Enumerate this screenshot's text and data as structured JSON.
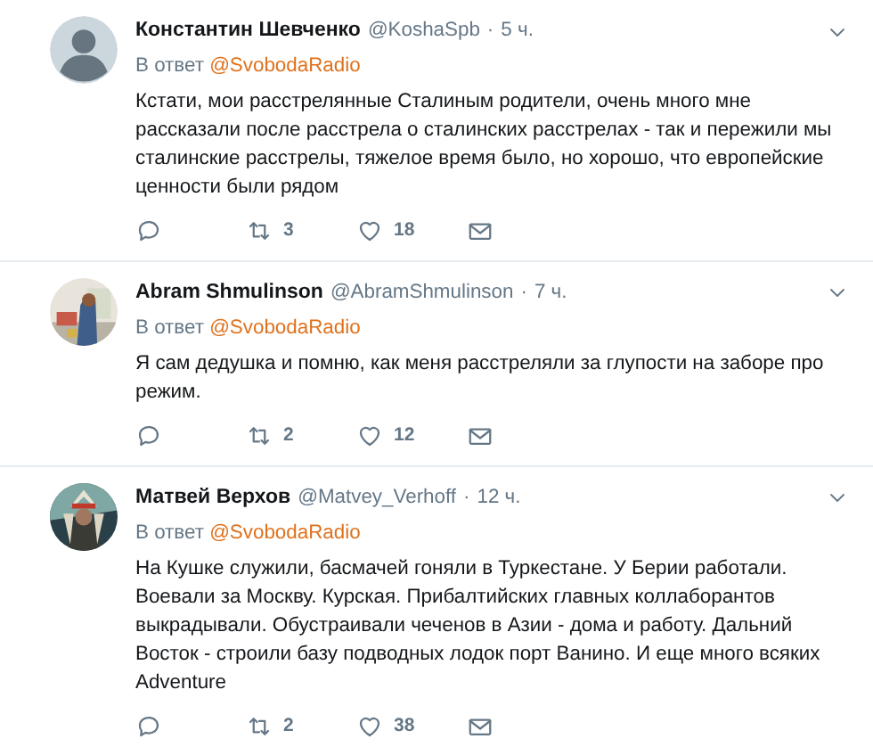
{
  "tweets": [
    {
      "avatar": {
        "kind": "default"
      },
      "name": "Константин Шевченко",
      "handle": "@KoshaSpb",
      "separator": "·",
      "time": "5 ч.",
      "reply_prefix": "В ответ",
      "reply_to": "@SvobodaRadio",
      "text": "Кстати, мои расстрелянные Сталиным родители, очень много мне рассказали после расстрела о сталинских расстрелах - так и пережили мы сталинские расстрелы, тяжелое время было, но хорошо, что европейские ценности были рядом",
      "retweets": "3",
      "likes": "18"
    },
    {
      "name": "Abram Shmulinson",
      "handle": "@AbramShmulinson",
      "separator": "·",
      "time": "7 ч.",
      "reply_prefix": "В ответ",
      "reply_to": "@SvobodaRadio",
      "text": "Я сам дедушка и помню, как меня расстреляли за глупости на заборе про режим.",
      "retweets": "2",
      "likes": "12"
    },
    {
      "name": "Матвей Верхов",
      "handle": "@Matvey_Verhoff",
      "separator": "·",
      "time": "12 ч.",
      "reply_prefix": "В ответ",
      "reply_to": "@SvobodaRadio",
      "text": "На Кушке служили, басмачей гоняли в Туркестане. У Берии работали. Воевали за Москву. Курская. Прибалтийских главных коллаборантов выкрадывали. Обустраивали чеченов в Азии - дома и работу. Дальний Восток - строили базу подводных лодок порт Ванино. И еще много всяких Adventure",
      "retweets": "2",
      "likes": "38"
    }
  ]
}
